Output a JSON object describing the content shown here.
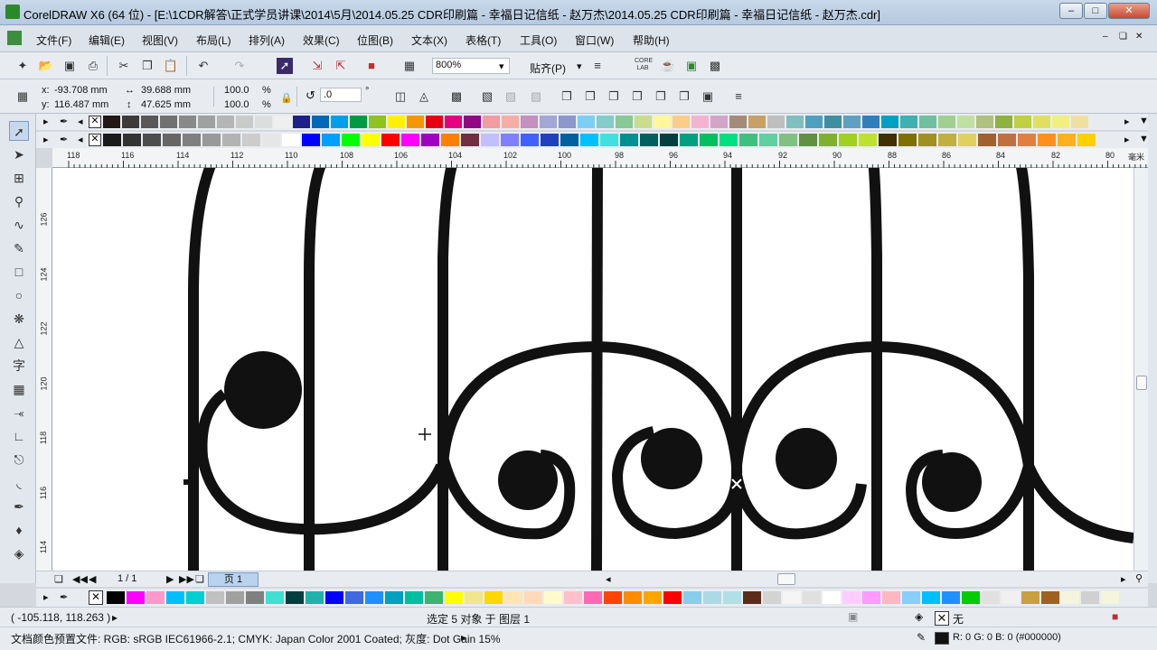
{
  "window": {
    "title": "CorelDRAW X6 (64 位) - [E:\\1CDR解答\\正式学员讲课\\2014\\5月\\2014.05.25 CDR印刷篇 - 幸福日记信纸 - 赵万杰\\2014.05.25 CDR印刷篇 - 幸福日记信纸 - 赵万杰.cdr]"
  },
  "menu": [
    "文件(F)",
    "编辑(E)",
    "视图(V)",
    "布局(L)",
    "排列(A)",
    "效果(C)",
    "位图(B)",
    "文本(X)",
    "表格(T)",
    "工具(O)",
    "窗口(W)",
    "帮助(H)"
  ],
  "standard_toolbar": {
    "zoom": "800%",
    "snap": "贴齐(P)"
  },
  "property_bar": {
    "x": "-93.708 mm",
    "y": "116.487 mm",
    "width": "39.688 mm",
    "height": "47.625 mm",
    "scale_x": "100.0",
    "scale_y": "100.0",
    "pct": "%",
    "rotation": ".0",
    "degree": "°",
    "x_label": "x:",
    "y_label": "y:"
  },
  "ruler": {
    "h_ticks": [
      "118",
      "116",
      "114",
      "112",
      "110",
      "108",
      "106",
      "104",
      "102",
      "100",
      "98",
      "96",
      "94",
      "92",
      "90",
      "88",
      "86",
      "84",
      "82",
      "80"
    ],
    "unit": "毫米",
    "v_ticks": [
      "126",
      "124",
      "122",
      "120",
      "118",
      "116",
      "114"
    ]
  },
  "page_nav": {
    "count": "1 / 1",
    "tab": "页 1"
  },
  "status": {
    "cursor": "( -105.118, 118.263 )",
    "selection": "选定 5 对象 于 图层 1",
    "fill_label": "无",
    "profile": "文档颜色预置文件: RGB: sRGB IEC61966-2.1; CMYK: Japan Color 2001 Coated; 灰度: Dot Gain 15%",
    "outline_color": "R: 0 G: 0 B: 0 (#000000)"
  },
  "palette_top1": [
    "#231815",
    "#3e3a39",
    "#595757",
    "#727171",
    "#898989",
    "#9fa0a0",
    "#b5b5b6",
    "#c9caca",
    "#dcdddd",
    "#efefef",
    "#1d2088",
    "#0068b7",
    "#00a0e9",
    "#009944",
    "#8fc31f",
    "#fff100",
    "#f39800",
    "#e60012",
    "#e4007f",
    "#920783",
    "#f29c9f",
    "#f6ada6",
    "#c490bf",
    "#a3a7d6",
    "#8c97cb",
    "#7ecef4",
    "#84ccc9",
    "#89c997",
    "#c9dd8a",
    "#fff799",
    "#facd89",
    "#f4b4d0",
    "#d3a4c8",
    "#a48b78",
    "#c8a063",
    "#bfbfbf",
    "#7fbfbf",
    "#4f9fbf",
    "#3f8fa0",
    "#5fa0c0",
    "#2f7fbf",
    "#00a0c0",
    "#40b0b0",
    "#70c0a0",
    "#a0d090",
    "#c0e0a0",
    "#b0c080",
    "#90b040",
    "#c0d040",
    "#e0e060",
    "#f0f080",
    "#f0e0a0"
  ],
  "palette_top2": [
    "#1a1a1a",
    "#333333",
    "#4d4d4d",
    "#666666",
    "#808080",
    "#999999",
    "#b3b3b3",
    "#cccccc",
    "#e6e6e6",
    "#ffffff",
    "#0000ff",
    "#00a0ff",
    "#00ff00",
    "#ffff00",
    "#ff0000",
    "#ff00ff",
    "#a000c0",
    "#ff8000",
    "#703040",
    "#c0c0ff",
    "#8080ff",
    "#4060ff",
    "#2040c0",
    "#0060a0",
    "#00c0ff",
    "#40e0e0",
    "#009090",
    "#006060",
    "#004040",
    "#00a080",
    "#00c060",
    "#00e080",
    "#40c080",
    "#60d0a0",
    "#80c080",
    "#609040",
    "#80b030",
    "#a0d020",
    "#c0e030",
    "#403000",
    "#807000",
    "#a09020",
    "#c0b040",
    "#e0d060",
    "#a06030",
    "#c07040",
    "#e08040",
    "#ff9020",
    "#ffb020",
    "#ffd000"
  ],
  "palette_bottom": [
    "#000000",
    "#ff00ff",
    "#ff99cc",
    "#00bfff",
    "#00ced1",
    "#c0c0c0",
    "#a0a0a0",
    "#808080",
    "#40e0d0",
    "#004040",
    "#20b2aa",
    "#0000ff",
    "#4169e1",
    "#1e90ff",
    "#00a0c0",
    "#00bfa0",
    "#3cb371",
    "#ffff00",
    "#f0e68c",
    "#ffd700",
    "#ffe4b5",
    "#ffdab9",
    "#fffacd",
    "#ffc0cb",
    "#ff69b4",
    "#ff4500",
    "#ff8c00",
    "#ffa500",
    "#ff0000",
    "#87ceeb",
    "#add8e6",
    "#b0e0e6",
    "#5a2d1a",
    "#d3d3d3",
    "#f5f5f5",
    "#e0e0e0",
    "#ffffff",
    "#ffccff",
    "#ff99ff",
    "#ffb6c1",
    "#87cefa",
    "#00bfff",
    "#1e90ff",
    "#00cc00",
    "#e0e0e0",
    "#f0f0f0",
    "#c8a040",
    "#a06020",
    "#f5f5dc",
    "#d0d0d0",
    "#f5f5dc"
  ]
}
